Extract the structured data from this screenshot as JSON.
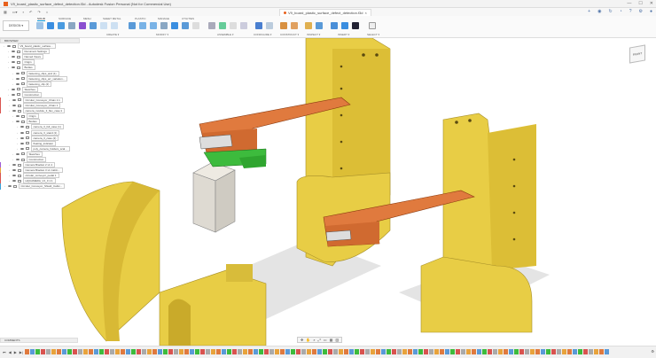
{
  "window": {
    "title": "V9_board_plastic_surface_defect_detection.f3d - Autodesk Fusion Personal (Not for Commercial Use)",
    "doc_tab": "V9_board_plastic_surface_defect_detection.f3d",
    "controls": [
      "—",
      "☐",
      "✕"
    ]
  },
  "ribbon": {
    "workspace": "DESIGN ▾",
    "tabs": [
      "SOLID",
      "SURFACE",
      "MESH",
      "SHEET METAL",
      "PLASTIC",
      "MANAGE",
      "UTILITIES"
    ],
    "groups": [
      "CREATE ▾",
      "MODIFY ▾",
      "ASSEMBLE ▾",
      "CONFIGURE ▾",
      "CONSTRUCT ▾",
      "INSPECT ▾",
      "INSERT ▾",
      "SELECT ▾"
    ]
  },
  "browser": {
    "title": "BROWSER",
    "nodes": [
      {
        "label": "V9_board_plastic_surface...",
        "depth": 0,
        "color": ""
      },
      {
        "label": "Document Settings",
        "depth": 1,
        "color": ""
      },
      {
        "label": "Named Views",
        "depth": 1,
        "color": ""
      },
      {
        "label": "Origin",
        "depth": 1,
        "color": ""
      },
      {
        "label": "Bodies",
        "depth": 1,
        "color": ""
      },
      {
        "label": "fastening_clips_and (1)",
        "depth": 2,
        "color": ""
      },
      {
        "label": "fastening_clips_arr_variation...",
        "depth": 2,
        "color": ""
      },
      {
        "label": "fastening_clip (2)",
        "depth": 2,
        "color": ""
      },
      {
        "label": "Sketches",
        "depth": 1,
        "color": ""
      },
      {
        "label": "Construction",
        "depth": 1,
        "color": ""
      },
      {
        "label": "Circular_Conveyor_Chain 1:1",
        "depth": 1,
        "color": "#d9534f"
      },
      {
        "label": "Circular_Conveyor_Chain 1",
        "depth": 1,
        "color": "#d9534f"
      },
      {
        "label": "camera_module_3_flex_case:1",
        "depth": 1,
        "color": "#d9534f"
      },
      {
        "label": "Origin",
        "depth": 2,
        "color": ""
      },
      {
        "label": "Bodies",
        "depth": 2,
        "color": ""
      },
      {
        "label": "camera_3_full_case (1)",
        "depth": 3,
        "color": ""
      },
      {
        "label": "camera_3_stand (1)",
        "depth": 3,
        "color": ""
      },
      {
        "label": "camera_3_case (2)",
        "depth": 3,
        "color": ""
      },
      {
        "label": "floating_indicator",
        "depth": 3,
        "color": ""
      },
      {
        "label": "poly_camera_holders_scal...",
        "depth": 3,
        "color": ""
      },
      {
        "label": "Sketches",
        "depth": 2,
        "color": ""
      },
      {
        "label": "Construction",
        "depth": 2,
        "color": ""
      },
      {
        "label": "Camera Bracket 2 v1:1",
        "depth": 1,
        "color": "#a05cd6"
      },
      {
        "label": "Camera Bracket 3 v1 Cabin...",
        "depth": 1,
        "color": "#e8a33c"
      },
      {
        "label": "circular_conveyor_pedal 1",
        "depth": 1,
        "color": "#d9534f"
      },
      {
        "label": "HQCAMERA_V1_0 1:1",
        "depth": 1,
        "color": "#d9534f"
      },
      {
        "label": "Circular_Conveyor_Shield_Cabin...",
        "depth": 0,
        "color": "#3aa0d8"
      }
    ]
  },
  "comments": {
    "label": "COMMENTS"
  },
  "viewcube": {
    "label": "FRONT"
  },
  "colors": {
    "yellow": "#e8cd45",
    "orange": "#e07a3e",
    "green": "#3dbb3d",
    "grey": "#dedad2"
  }
}
